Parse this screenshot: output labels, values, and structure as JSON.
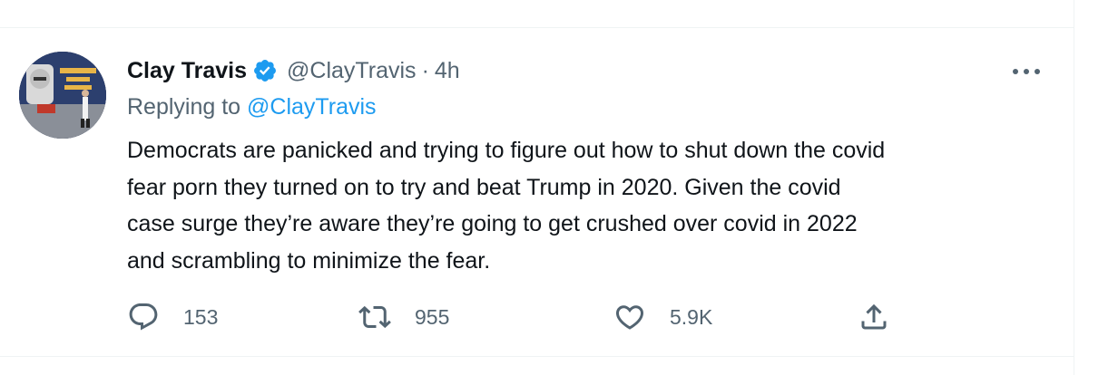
{
  "tweet": {
    "author": {
      "name": "Clay Travis",
      "handle": "@ClayTravis",
      "verified": true,
      "avatar_icon": "profile-photo"
    },
    "time_separator": "·",
    "timestamp": "4h",
    "replying_prefix": "Replying to",
    "replying_to": "@ClayTravis",
    "text_lines": [
      "Democrats are panicked and trying to figure out how to shut down the covid",
      "fear porn they turned on to try and beat Trump in 2020. Given the covid",
      "case surge they’re aware they’re going to get crushed over covid in 2022",
      "and scrambling to minimize the fear."
    ],
    "actions": {
      "reply": {
        "icon": "reply-icon",
        "count": "153"
      },
      "retweet": {
        "icon": "retweet-icon",
        "count": "955"
      },
      "like": {
        "icon": "heart-icon",
        "count": "5.9K"
      },
      "share": {
        "icon": "share-icon"
      }
    }
  },
  "colors": {
    "text": "#0f1419",
    "secondary": "#536471",
    "link": "#1d9bf0",
    "border": "#eff3f4",
    "verified": "#1d9bf0"
  }
}
